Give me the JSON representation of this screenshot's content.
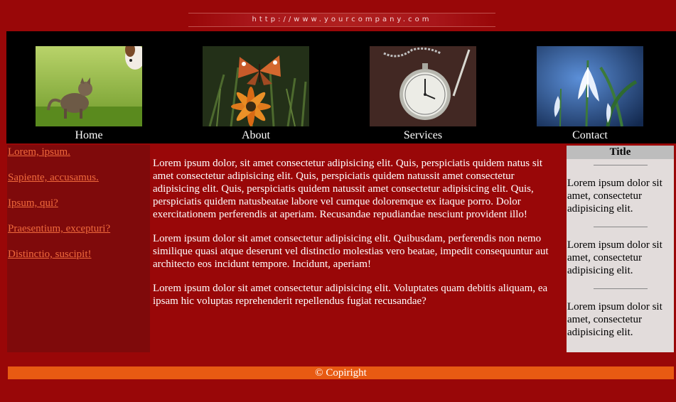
{
  "header": {
    "url": "http://www.yourcompany.com"
  },
  "nav": {
    "items": [
      {
        "label": "Home",
        "image": "kitten-puppy-photo"
      },
      {
        "label": "About",
        "image": "butterfly-flower-photo"
      },
      {
        "label": "Services",
        "image": "pocket-watch-photo"
      },
      {
        "label": "Contact",
        "image": "snowdrop-flower-photo"
      }
    ]
  },
  "sidebar": {
    "links": [
      "Lorem, ipsum.",
      "Sapiente, accusamus.",
      "Ipsum, qui?",
      "Praesentium, excepturi?",
      "Distinctio, suscipit!"
    ]
  },
  "main": {
    "paragraphs": [
      "Lorem ipsum dolor, sit amet consectetur adipisicing elit. Quis, perspiciatis quidem natus sit amet consectetur adipisicing elit. Quis, perspiciatis quidem natussit amet consectetur adipisicing elit. Quis, perspiciatis quidem natussit amet consectetur adipisicing elit. Quis, perspiciatis quidem natusbeatae labore vel cumque doloremque ex itaque porro. Dolor exercitationem perferendis at aperiam. Recusandae repudiandae nesciunt provident illo!",
      "Lorem ipsum dolor sit amet consectetur adipisicing elit. Quibusdam, perferendis non nemo similique quasi atque deserunt vel distinctio molestias vero beatae, impedit consequuntur aut architecto eos incidunt tempore. Incidunt, aperiam!",
      "Lorem ipsum dolor sit amet consectetur adipisicing elit. Voluptates quam debitis aliquam, ea ipsam hic voluptas reprehenderit repellendus fugiat recusandae?"
    ]
  },
  "aside": {
    "title": "Title",
    "items": [
      "Lorem ipsum dolor sit amet, consectetur adipisicing elit.",
      "Lorem ipsum dolor sit amet, consectetur adipisicing elit.",
      "Lorem ipsum dolor sit amet, consectetur adipisicing elit."
    ]
  },
  "footer": {
    "text": "© Copiright"
  },
  "colors": {
    "background": "#990708",
    "nav_bg": "#000000",
    "sidebar_bg": "#7f0a0b",
    "link": "#f06a3c",
    "aside_bg": "#e2dcdb",
    "footer_bg": "#e85a12"
  }
}
